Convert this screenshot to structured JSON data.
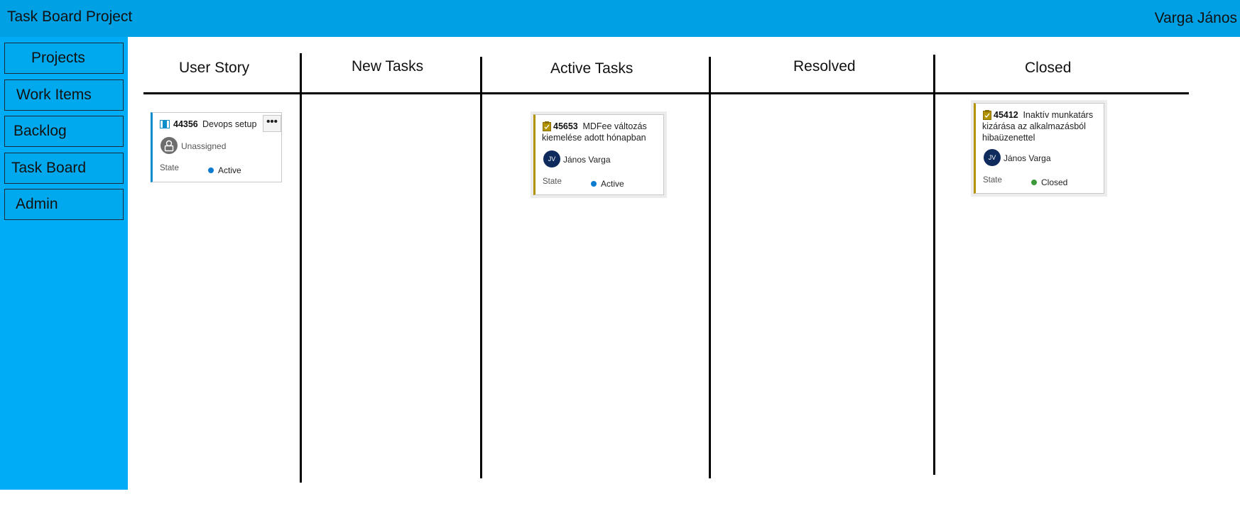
{
  "app": {
    "title": "Task Board Project",
    "user": "Varga János"
  },
  "nav": [
    {
      "label": "Projects"
    },
    {
      "label": "Work Items"
    },
    {
      "label": "Backlog"
    },
    {
      "label": "Task Board"
    },
    {
      "label": "Admin"
    }
  ],
  "columns": [
    {
      "title": "User Story"
    },
    {
      "title": "New Tasks"
    },
    {
      "title": "Active Tasks"
    },
    {
      "title": "Resolved"
    },
    {
      "title": "Closed"
    }
  ],
  "cards": {
    "story": {
      "id": "44356",
      "title": "Devops setup",
      "assignee": "Unassigned",
      "state_label": "State",
      "state": "Active",
      "state_color": "#0c7bd0",
      "more": "•••"
    },
    "active_task": {
      "id": "45653",
      "title": "MDFee változás kiemelése adott hónapban",
      "assignee": "János Varga",
      "initials": "JV",
      "state_label": "State",
      "state": "Active",
      "state_color": "#0c7bd0"
    },
    "closed_task": {
      "id": "45412",
      "title": "Inaktív munkatárs kizárása az alkalmazásból hibaüzenettel",
      "assignee": "János Varga",
      "initials": "JV",
      "state_label": "State",
      "state": "Closed",
      "state_color": "#3a9a3a"
    }
  },
  "colors": {
    "topbar": "#00a0e4",
    "sidebar": "#00acf5",
    "story_accent": "#0c8ecb",
    "task_accent": "#b39300"
  }
}
